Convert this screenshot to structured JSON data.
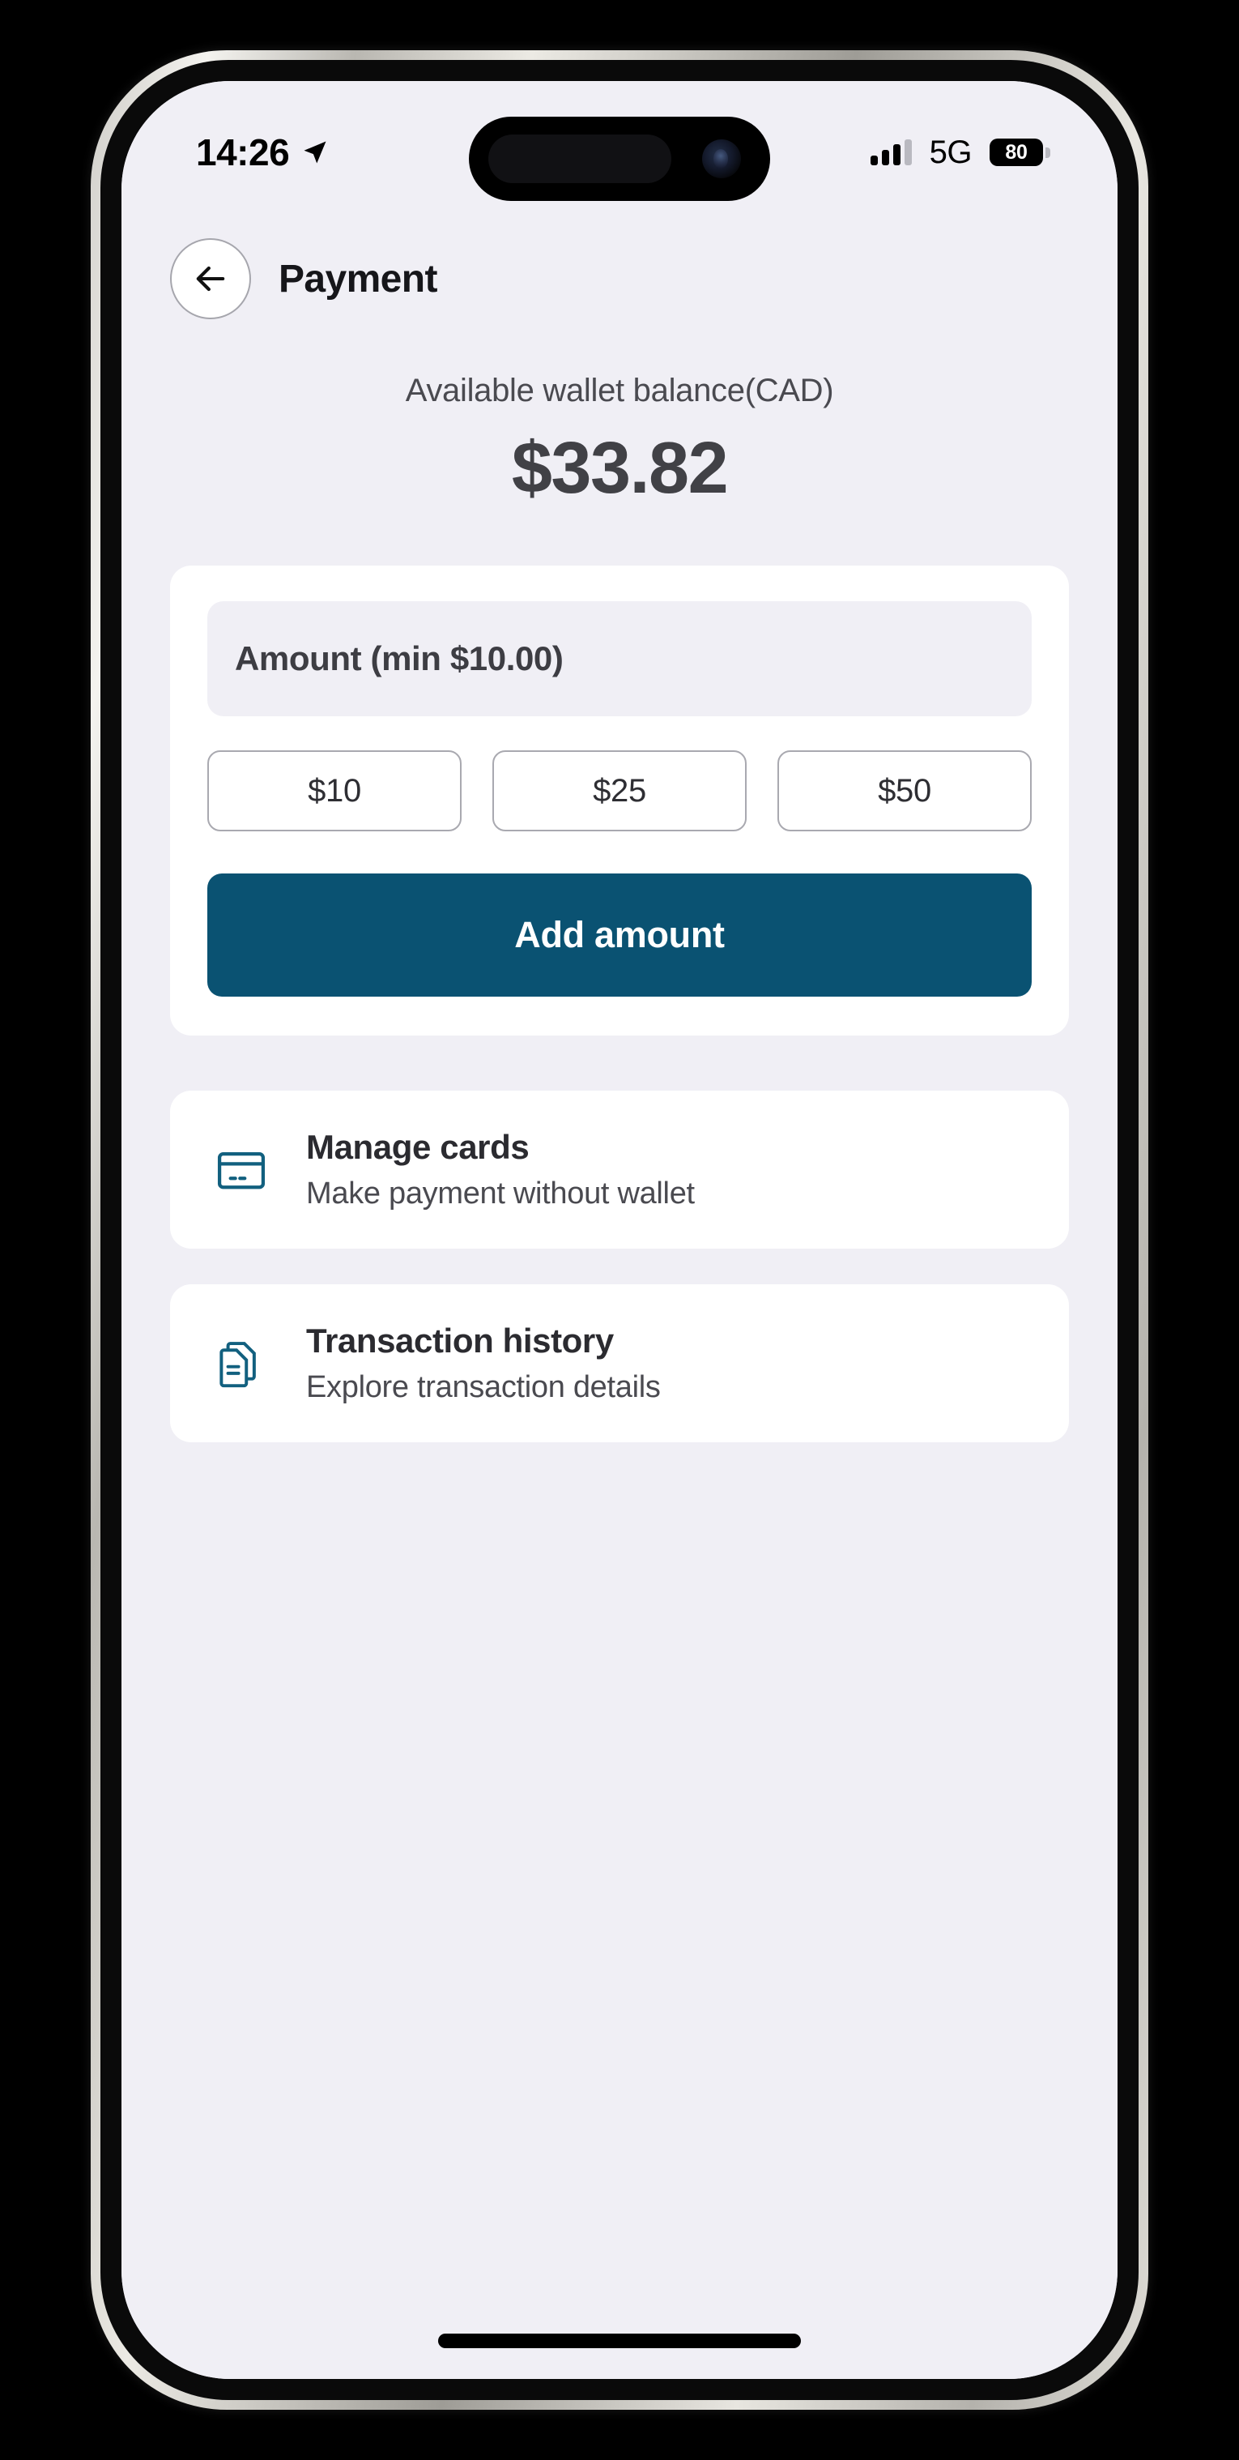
{
  "status_bar": {
    "time": "14:26",
    "location_icon": "location-arrow-icon",
    "signal_icon": "cellular-signal-icon",
    "network": "5G",
    "battery_level": "80"
  },
  "header": {
    "back_icon": "arrow-left-icon",
    "title": "Payment"
  },
  "balance": {
    "label": "Available wallet balance(CAD)",
    "amount": "$33.82"
  },
  "amount_section": {
    "input_placeholder": "Amount (min $10.00)",
    "input_value": "",
    "quick_amounts": [
      {
        "label": "$10"
      },
      {
        "label": "$25"
      },
      {
        "label": "$50"
      }
    ],
    "submit_label": "Add amount"
  },
  "menu_items": [
    {
      "icon": "credit-card-icon",
      "title": "Manage cards",
      "subtitle": "Make payment without wallet"
    },
    {
      "icon": "documents-icon",
      "title": "Transaction history",
      "subtitle": "Explore transaction details"
    }
  ],
  "colors": {
    "background": "#f0eff5",
    "card": "#ffffff",
    "primary": "#0a5272",
    "text_dark": "#2b2b30",
    "text_muted": "#4a4a50"
  }
}
